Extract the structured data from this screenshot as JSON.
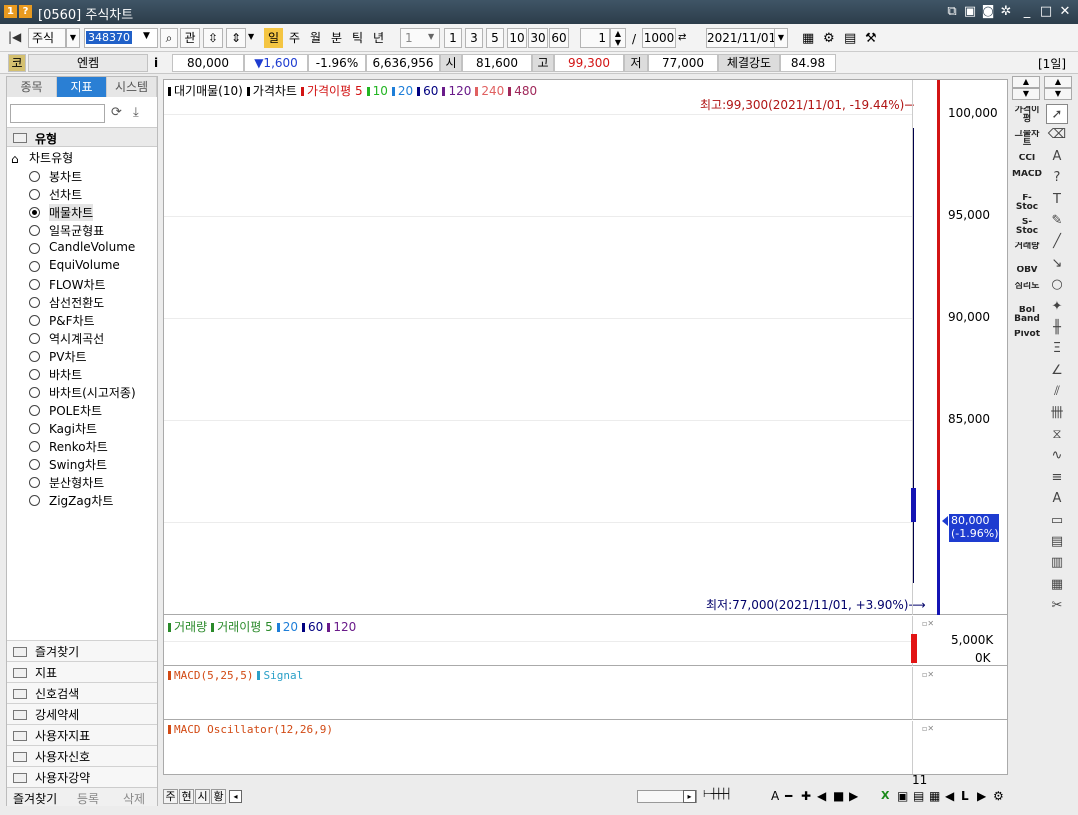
{
  "window": {
    "title": "[0560] 주식차트",
    "badge1": "1",
    "badge2": "?",
    "icons": [
      "restore-icon",
      "settings-icon",
      "minimize-icon",
      "maximize-icon",
      "close-icon"
    ],
    "min": "_",
    "max": "□",
    "close": "✕"
  },
  "toolbar": {
    "market": "주식",
    "code": "348370",
    "rel": "관",
    "periods": [
      "일",
      "주",
      "월",
      "분",
      "틱",
      "년"
    ],
    "interval": "1",
    "quick": [
      "1",
      "3",
      "5",
      "10",
      "30",
      "60"
    ],
    "count": "1",
    "slash": "/",
    "total": "1000",
    "date": "2021/11/01"
  },
  "info": {
    "name_tag": "코",
    "name": "엔켐",
    "i": "i",
    "price": "80,000",
    "change": "▼1,600",
    "rate": "-1.96%",
    "volume": "6,636,956",
    "open_label": "시",
    "open": "81,600",
    "high_label": "고",
    "high": "99,300",
    "low_label": "저",
    "low": "77,000",
    "strength_label": "체결강도",
    "strength": "84.98",
    "period": "[1일]"
  },
  "left": {
    "tabs": [
      "종목",
      "지표",
      "시스템"
    ],
    "group": "유형",
    "subgroup": "차트유형",
    "types": [
      "봉차트",
      "선차트",
      "매물차트",
      "일목균형표",
      "CandleVolume",
      "EquiVolume",
      "FLOW차트",
      "삼선전환도",
      "P&F차트",
      "역시계곡선",
      "PV차트",
      "바차트",
      "바차트(시고저종)",
      "POLE차트",
      "Kagi차트",
      "Renko차트",
      "Swing차트",
      "분산형차트",
      "ZigZag차트"
    ],
    "selected": 2,
    "folders": [
      "즐겨찾기",
      "지표",
      "신호검색",
      "강세약세",
      "사용자지표",
      "사용자신호",
      "사용자강약"
    ],
    "bottom": [
      "즐겨찾기",
      "등록",
      "삭제"
    ]
  },
  "chart": {
    "price_legend": {
      "items": [
        {
          "t": "대기매물(10)",
          "c": "#000"
        },
        {
          "t": "가격차트",
          "c": "#000"
        },
        {
          "t": "가격이평 5",
          "c": "#d21414"
        },
        {
          "t": "10",
          "c": "#22b522"
        },
        {
          "t": "20",
          "c": "#1e7ed8"
        },
        {
          "t": "60",
          "c": "#000080"
        },
        {
          "t": "120",
          "c": "#6a1b8a"
        },
        {
          "t": "240",
          "c": "#e06060"
        },
        {
          "t": "480",
          "c": "#a0285a"
        }
      ]
    },
    "high_note": "최고:99,300(2021/11/01, -19.44%)",
    "low_note": "최저:77,000(2021/11/01, +3.90%)",
    "arrow": "⟶",
    "y_ticks": [
      "100,000",
      "95,000",
      "90,000",
      "85,000"
    ],
    "current": {
      "price": "80,000",
      "pct": "(-1.96%)"
    },
    "volume_legend": [
      {
        "t": "거래량",
        "c": "#2a8a2a"
      },
      {
        "t": "거래이평 5",
        "c": "#2a8a2a"
      },
      {
        "t": "20",
        "c": "#1e7ed8"
      },
      {
        "t": "60",
        "c": "#000080"
      },
      {
        "t": "120",
        "c": "#6a1b8a"
      }
    ],
    "vol_ticks": [
      "5,000K",
      "0K"
    ],
    "macd_legend": [
      {
        "t": "MACD(5,25,5)",
        "c": "#d24a14"
      },
      {
        "t": "Signal",
        "c": "#2aa0c8"
      }
    ],
    "osc_legend": [
      {
        "t": "MACD Oscillator(12,26,9)",
        "c": "#d24a14"
      }
    ],
    "x_label": "11"
  },
  "indicators": [
    "가격이평",
    "그물차트",
    "CCI",
    "MACD",
    "F-Stoc",
    "S-Stoc",
    "거래량",
    "OBV",
    "심리도",
    "Bol Band",
    "Pivot"
  ],
  "tools": [
    "cursor-icon",
    "eraser-icon",
    "all-icon",
    "question-icon",
    "text-icon",
    "brush-icon",
    "line-icon",
    "ray-icon",
    "circle-icon",
    "pointer-icon",
    "fib-icon",
    "trend-icon",
    "angle-icon",
    "parallel-icon",
    "gann-icon",
    "speed-icon",
    "wave-icon",
    "level-icon",
    "auto-icon",
    "window-icon",
    "doc-icon",
    "chart-icon",
    "settings2-icon",
    "wrench-icon"
  ],
  "bottombar": [
    "주",
    "현",
    "시",
    "황"
  ],
  "bottom_glyphs": {
    "left": "◂",
    "right": "▸",
    "ruler": "⊢┼┼┼┤",
    "a": "A",
    "minus": "━",
    "plus": "✚",
    "back": "◀",
    "stop": "■",
    "play": "▶",
    "excel": "X",
    "save": "▣",
    "print": "▤",
    "img": "▦",
    "prev": "◀",
    "mark": "L",
    "next": "▶",
    "wrench": "⚙"
  }
}
